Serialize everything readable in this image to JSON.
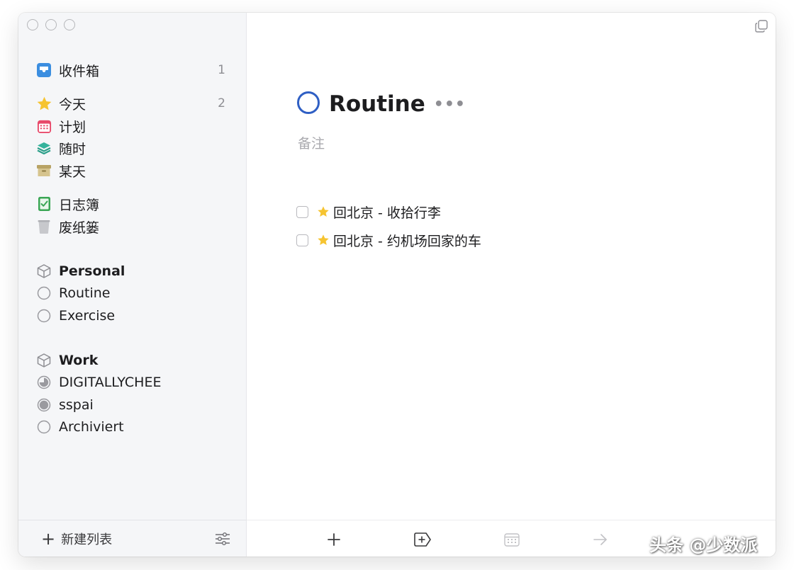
{
  "sidebar": {
    "inbox": {
      "label": "收件箱",
      "count": "1",
      "icon": "inbox-icon"
    },
    "today": {
      "label": "今天",
      "count": "2",
      "icon": "star-icon"
    },
    "upcoming": {
      "label": "计划",
      "icon": "calendar-icon"
    },
    "anytime": {
      "label": "随时",
      "icon": "layers-icon"
    },
    "someday": {
      "label": "某天",
      "icon": "archive-box-icon"
    },
    "logbook": {
      "label": "日志簿",
      "icon": "logbook-icon"
    },
    "trash": {
      "label": "废纸篓",
      "icon": "trash-icon"
    },
    "areas": [
      {
        "label": "Personal",
        "projects": [
          {
            "label": "Routine",
            "selected": true
          },
          {
            "label": "Exercise"
          }
        ]
      },
      {
        "label": "Work",
        "projects": [
          {
            "label": "DIGITALLYCHEE",
            "progress": 0.25
          },
          {
            "label": "sspai",
            "progress": 1.0
          },
          {
            "label": "Archiviert",
            "progress": 0
          }
        ]
      }
    ],
    "footer": {
      "new_list_label": "新建列表"
    }
  },
  "main": {
    "project_title": "Routine",
    "more_label": "•••",
    "notes_placeholder": "备注",
    "tasks": [
      {
        "title": "回北京 - 收拾行李",
        "starred": true,
        "done": false
      },
      {
        "title": "回北京 - 约机场回家的车",
        "starred": true,
        "done": false
      }
    ]
  },
  "watermark": "头条 @少数派",
  "colors": {
    "inbox": "#3b8ee0",
    "today_star": "#f6c431",
    "upcoming": "#e8496a",
    "anytime": "#2c9f8a",
    "someday": "#c9b47a",
    "logbook": "#3aa655",
    "project_ring": "#2f5fc4"
  }
}
